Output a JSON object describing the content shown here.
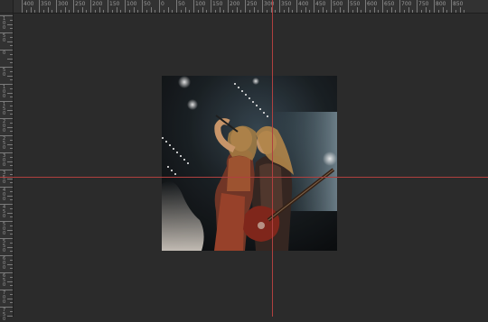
{
  "app": {
    "view": "canvas",
    "colors": {
      "workspace": "#2b2b2b",
      "ruler": "#323232",
      "guide": "#b0403f"
    }
  },
  "rulers": {
    "top_labels": [
      "400",
      "350",
      "300",
      "250",
      "200",
      "150",
      "100",
      "50",
      "0",
      "50",
      "100",
      "150",
      "200",
      "250",
      "300",
      "350",
      "400",
      "450",
      "500",
      "550",
      "600",
      "650",
      "700",
      "750",
      "800",
      "850"
    ],
    "left_labels": [
      "100",
      "50",
      "0",
      "50",
      "100",
      "150",
      "200",
      "250",
      "300",
      "350",
      "400",
      "450",
      "500",
      "550",
      "600",
      "650",
      "700",
      "750"
    ]
  },
  "document": {
    "image_label": "concert-photo"
  }
}
